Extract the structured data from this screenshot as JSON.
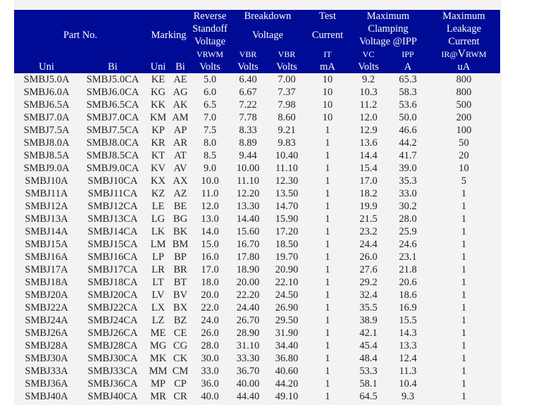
{
  "header": {
    "part_no": "Part No.",
    "marking": "Marking",
    "reverse_standoff": [
      "Reverse",
      "Standoff",
      "Voltage"
    ],
    "breakdown": [
      "Breakdown",
      "Voltage"
    ],
    "test_current": [
      "Test",
      "Current"
    ],
    "max_clamping": [
      "Maximum",
      "Clamping",
      "Voltage @IPP"
    ],
    "max_leakage": [
      "Maximum",
      "Leakage",
      "Current"
    ],
    "symbols": {
      "vrwm": "VRWM",
      "vbr_min": "VBR",
      "vbr_max": "VBR",
      "it": "IT",
      "vc": "VC",
      "ipp": "IPP",
      "ir_prefix": "IR@",
      "ir_v": "V",
      "ir_suffix": "RWM"
    },
    "sub": {
      "uni": "Uni",
      "bi": "Bi",
      "mark_uni": "Uni",
      "mark_bi": "Bi",
      "vrwm_unit": "Volts",
      "vbr_min_unit": "Volts",
      "vbr_max_unit": "Volts",
      "it_unit": "mA",
      "vc_unit": "Volts",
      "ipp_unit": "A",
      "ir_unit": "uA"
    }
  },
  "rows": [
    [
      "SMBJ5.0A",
      "SMBJ5.0CA",
      "KE",
      "AE",
      "5.0",
      "6.40",
      "7.00",
      "10",
      "9.2",
      "65.3",
      "800"
    ],
    [
      "SMBJ6.0A",
      "SMBJ6.0CA",
      "KG",
      "AG",
      "6.0",
      "6.67",
      "7.37",
      "10",
      "10.3",
      "58.3",
      "800"
    ],
    [
      "SMBJ6.5A",
      "SMBJ6.5CA",
      "KK",
      "AK",
      "6.5",
      "7.22",
      "7.98",
      "10",
      "11.2",
      "53.6",
      "500"
    ],
    [
      "SMBJ7.0A",
      "SMBJ7.0CA",
      "KM",
      "AM",
      "7.0",
      "7.78",
      "8.60",
      "10",
      "12.0",
      "50.0",
      "200"
    ],
    [
      "SMBJ7.5A",
      "SMBJ7.5CA",
      "KP",
      "AP",
      "7.5",
      "8.33",
      "9.21",
      "1",
      "12.9",
      "46.6",
      "100"
    ],
    [
      "SMBJ8.0A",
      "SMBJ8.0CA",
      "KR",
      "AR",
      "8.0",
      "8.89",
      "9.83",
      "1",
      "13.6",
      "44.2",
      "50"
    ],
    [
      "SMBJ8.5A",
      "SMBJ8.5CA",
      "KT",
      "AT",
      "8.5",
      "9.44",
      "10.40",
      "1",
      "14.4",
      "41.7",
      "20"
    ],
    [
      "SMBJ9.0A",
      "SMBJ9.0CA",
      "KV",
      "AV",
      "9.0",
      "10.00",
      "11.10",
      "1",
      "15.4",
      "39.0",
      "10"
    ],
    [
      "SMBJ10A",
      "SMBJ10CA",
      "KX",
      "AX",
      "10.0",
      "11.10",
      "12.30",
      "1",
      "17.0",
      "35.3",
      "5"
    ],
    [
      "SMBJ11A",
      "SMBJ11CA",
      "KZ",
      "AZ",
      "11.0",
      "12.20",
      "13.50",
      "1",
      "18.2",
      "33.0",
      "1"
    ],
    [
      "SMBJ12A",
      "SMBJ12CA",
      "LE",
      "BE",
      "12.0",
      "13.30",
      "14.70",
      "1",
      "19.9",
      "30.2",
      "1"
    ],
    [
      "SMBJ13A",
      "SMBJ13CA",
      "LG",
      "BG",
      "13.0",
      "14.40",
      "15.90",
      "1",
      "21.5",
      "28.0",
      "1"
    ],
    [
      "SMBJ14A",
      "SMBJ14CA",
      "LK",
      "BK",
      "14.0",
      "15.60",
      "17.20",
      "1",
      "23.2",
      "25.9",
      "1"
    ],
    [
      "SMBJ15A",
      "SMBJ15CA",
      "LM",
      "BM",
      "15.0",
      "16.70",
      "18.50",
      "1",
      "24.4",
      "24.6",
      "1"
    ],
    [
      "SMBJ16A",
      "SMBJ16CA",
      "LP",
      "BP",
      "16.0",
      "17.80",
      "19.70",
      "1",
      "26.0",
      "23.1",
      "1"
    ],
    [
      "SMBJ17A",
      "SMBJ17CA",
      "LR",
      "BR",
      "17.0",
      "18.90",
      "20.90",
      "1",
      "27.6",
      "21.8",
      "1"
    ],
    [
      "SMBJ18A",
      "SMBJ18CA",
      "LT",
      "BT",
      "18.0",
      "20.00",
      "22.10",
      "1",
      "29.2",
      "20.6",
      "1"
    ],
    [
      "SMBJ20A",
      "SMBJ20CA",
      "LV",
      "BV",
      "20.0",
      "22.20",
      "24.50",
      "1",
      "32.4",
      "18.6",
      "1"
    ],
    [
      "SMBJ22A",
      "SMBJ22CA",
      "LX",
      "BX",
      "22.0",
      "24.40",
      "26.90",
      "1",
      "35.5",
      "16.9",
      "1"
    ],
    [
      "SMBJ24A",
      "SMBJ24CA",
      "LZ",
      "BZ",
      "24.0",
      "26.70",
      "29.50",
      "1",
      "38.9",
      "15.5",
      "1"
    ],
    [
      "SMBJ26A",
      "SMBJ26CA",
      "ME",
      "CE",
      "26.0",
      "28.90",
      "31.90",
      "1",
      "42.1",
      "14.3",
      "1"
    ],
    [
      "SMBJ28A",
      "SMBJ28CA",
      "MG",
      "CG",
      "28.0",
      "31.10",
      "34.40",
      "1",
      "45.4",
      "13.3",
      "1"
    ],
    [
      "SMBJ30A",
      "SMBJ30CA",
      "MK",
      "CK",
      "30.0",
      "33.30",
      "36.80",
      "1",
      "48.4",
      "12.4",
      "1"
    ],
    [
      "SMBJ33A",
      "SMBJ33CA",
      "MM",
      "CM",
      "33.0",
      "36.70",
      "40.60",
      "1",
      "53.3",
      "11.3",
      "1"
    ],
    [
      "SMBJ36A",
      "SMBJ36CA",
      "MP",
      "CP",
      "36.0",
      "40.00",
      "44.20",
      "1",
      "58.1",
      "10.4",
      "1"
    ],
    [
      "SMBJ40A",
      "SMBJ40CA",
      "MR",
      "CR",
      "40.0",
      "44.40",
      "49.10",
      "1",
      "64.5",
      "9.3",
      "1"
    ]
  ]
}
